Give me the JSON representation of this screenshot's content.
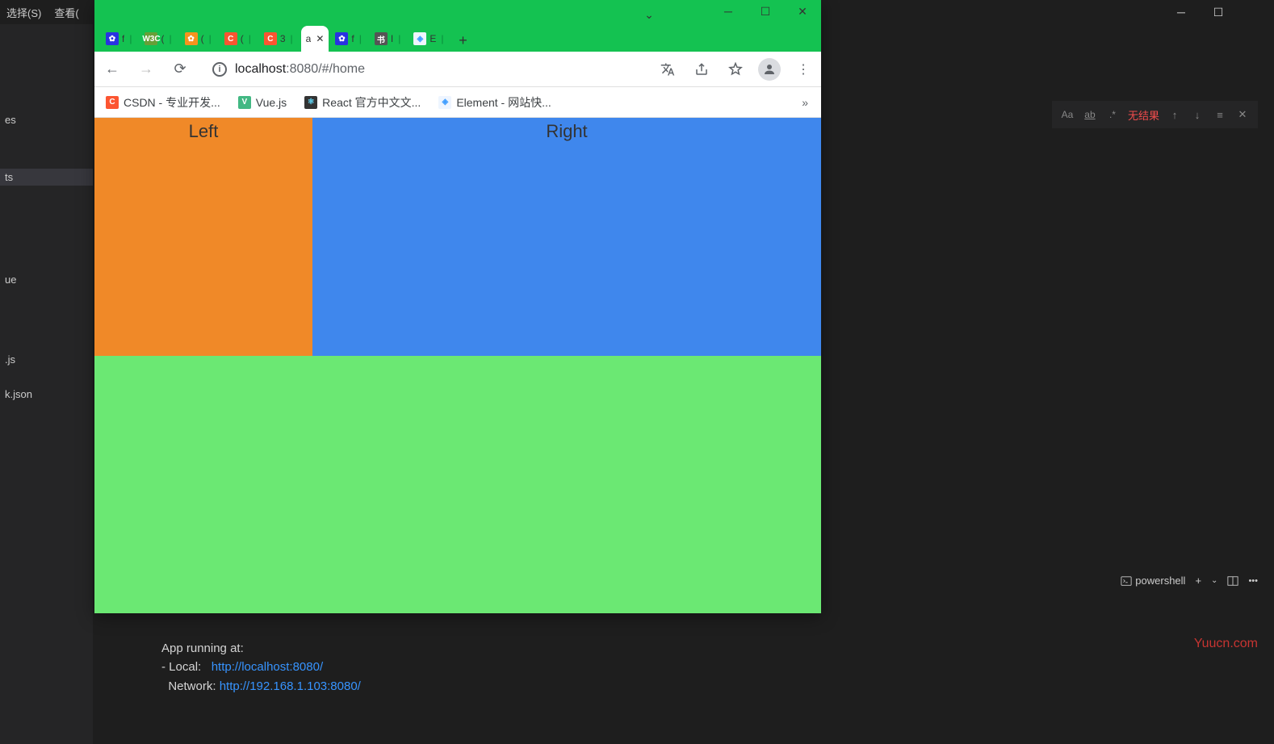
{
  "vscode": {
    "menu": {
      "select": "选择(S)",
      "view": "查看("
    },
    "sidebar_items": [
      "",
      "es",
      "",
      "ts",
      "",
      "",
      "",
      "ue",
      "",
      "",
      ".js",
      "k.json"
    ],
    "sidebar_active_index": 3,
    "findbar": {
      "aa": "Aa",
      "ab": "ab",
      "regex": ".*",
      "noresult": "无结果"
    },
    "terminal_panel": {
      "shell": "powershell"
    },
    "terminal": {
      "line1": "App running at:",
      "line2_prefix": "- Local:   ",
      "line2_url": "http://localhost:8080/",
      "line3_prefix": "  Network: ",
      "line3_url": "http://192.168.1.103:8080/"
    }
  },
  "browser": {
    "tabs": [
      {
        "fav": "fav-baidu",
        "glyph": "✿",
        "title": "f"
      },
      {
        "fav": "fav-w3c",
        "glyph": "W3C",
        "title": "("
      },
      {
        "fav": "fav-orange",
        "glyph": "✿",
        "title": "("
      },
      {
        "fav": "fav-c",
        "glyph": "C",
        "title": "("
      },
      {
        "fav": "fav-c",
        "glyph": "C",
        "title": "3"
      },
      {
        "fav": "",
        "glyph": "",
        "title": "a",
        "active": true
      },
      {
        "fav": "fav-baidu",
        "glyph": "✿",
        "title": "f"
      },
      {
        "fav": "fav-shu",
        "glyph": "书",
        "title": "I"
      },
      {
        "fav": "fav-el",
        "glyph": "◈",
        "title": "E"
      }
    ],
    "url": {
      "host": "localhost",
      "port": ":8080",
      "path": "/#/home"
    },
    "bookmarks": [
      {
        "fav": "fav-c",
        "glyph": "C",
        "label": "CSDN - 专业开发..."
      },
      {
        "fav": "fav-vue",
        "glyph": "V",
        "label": "Vue.js"
      },
      {
        "fav": "fav-react",
        "glyph": "⚛",
        "label": "React 官方中文文..."
      },
      {
        "fav": "fav-el",
        "glyph": "◈",
        "label": "Element - 网站快..."
      }
    ]
  },
  "page": {
    "left": "Left",
    "right": "Right"
  },
  "watermark": "Yuucn.com"
}
